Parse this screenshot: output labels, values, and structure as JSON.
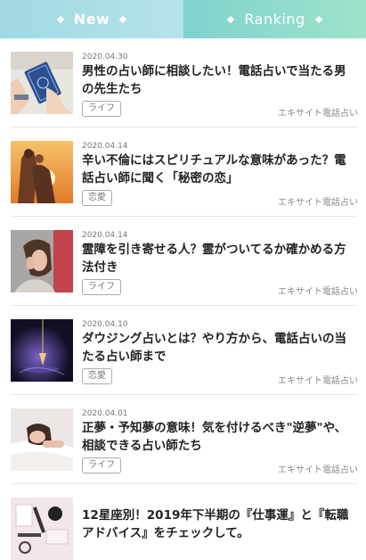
{
  "tabs": {
    "new_label": "New",
    "ranking_label": "Ranking"
  },
  "articles": [
    {
      "date": "2020.04.30",
      "title": "男性の占い師に相談したい！電話占いで当たる男の先生たち",
      "tag": "ライフ",
      "source": "エキサイト電話占い",
      "thumb_icon": "tarot-cards-image"
    },
    {
      "date": "2020.04.14",
      "title": "辛い不倫にはスピリチュアルな意味があった？電話占い師に聞く「秘密の恋」",
      "tag": "恋愛",
      "source": "エキサイト電話占い",
      "thumb_icon": "couple-sunset-image"
    },
    {
      "date": "2020.04.14",
      "title": "霊障を引き寄せる人？霊がついてるか確かめる方法付き",
      "tag": "ライフ",
      "source": "エキサイト電話占い",
      "thumb_icon": "woman-headache-image"
    },
    {
      "date": "2020.04.10",
      "title": "ダウジング占いとは？やり方から、電話占いの当たる占い師まで",
      "tag": "恋愛",
      "source": "エキサイト電話占い",
      "thumb_icon": "pendulum-image"
    },
    {
      "date": "2020.04.01",
      "title": "正夢・予知夢の意味！気を付けるべき\"逆夢\"や、相談できる占い師たち",
      "tag": "ライフ",
      "source": "エキサイト電話占い",
      "thumb_icon": "sleeping-woman-image"
    },
    {
      "date": "",
      "title": "12星座別！2019年下半期の『仕事運』と『転職アドバイス』をチェックして。",
      "tag": "",
      "source": "",
      "thumb_icon": "desk-items-image"
    }
  ]
}
